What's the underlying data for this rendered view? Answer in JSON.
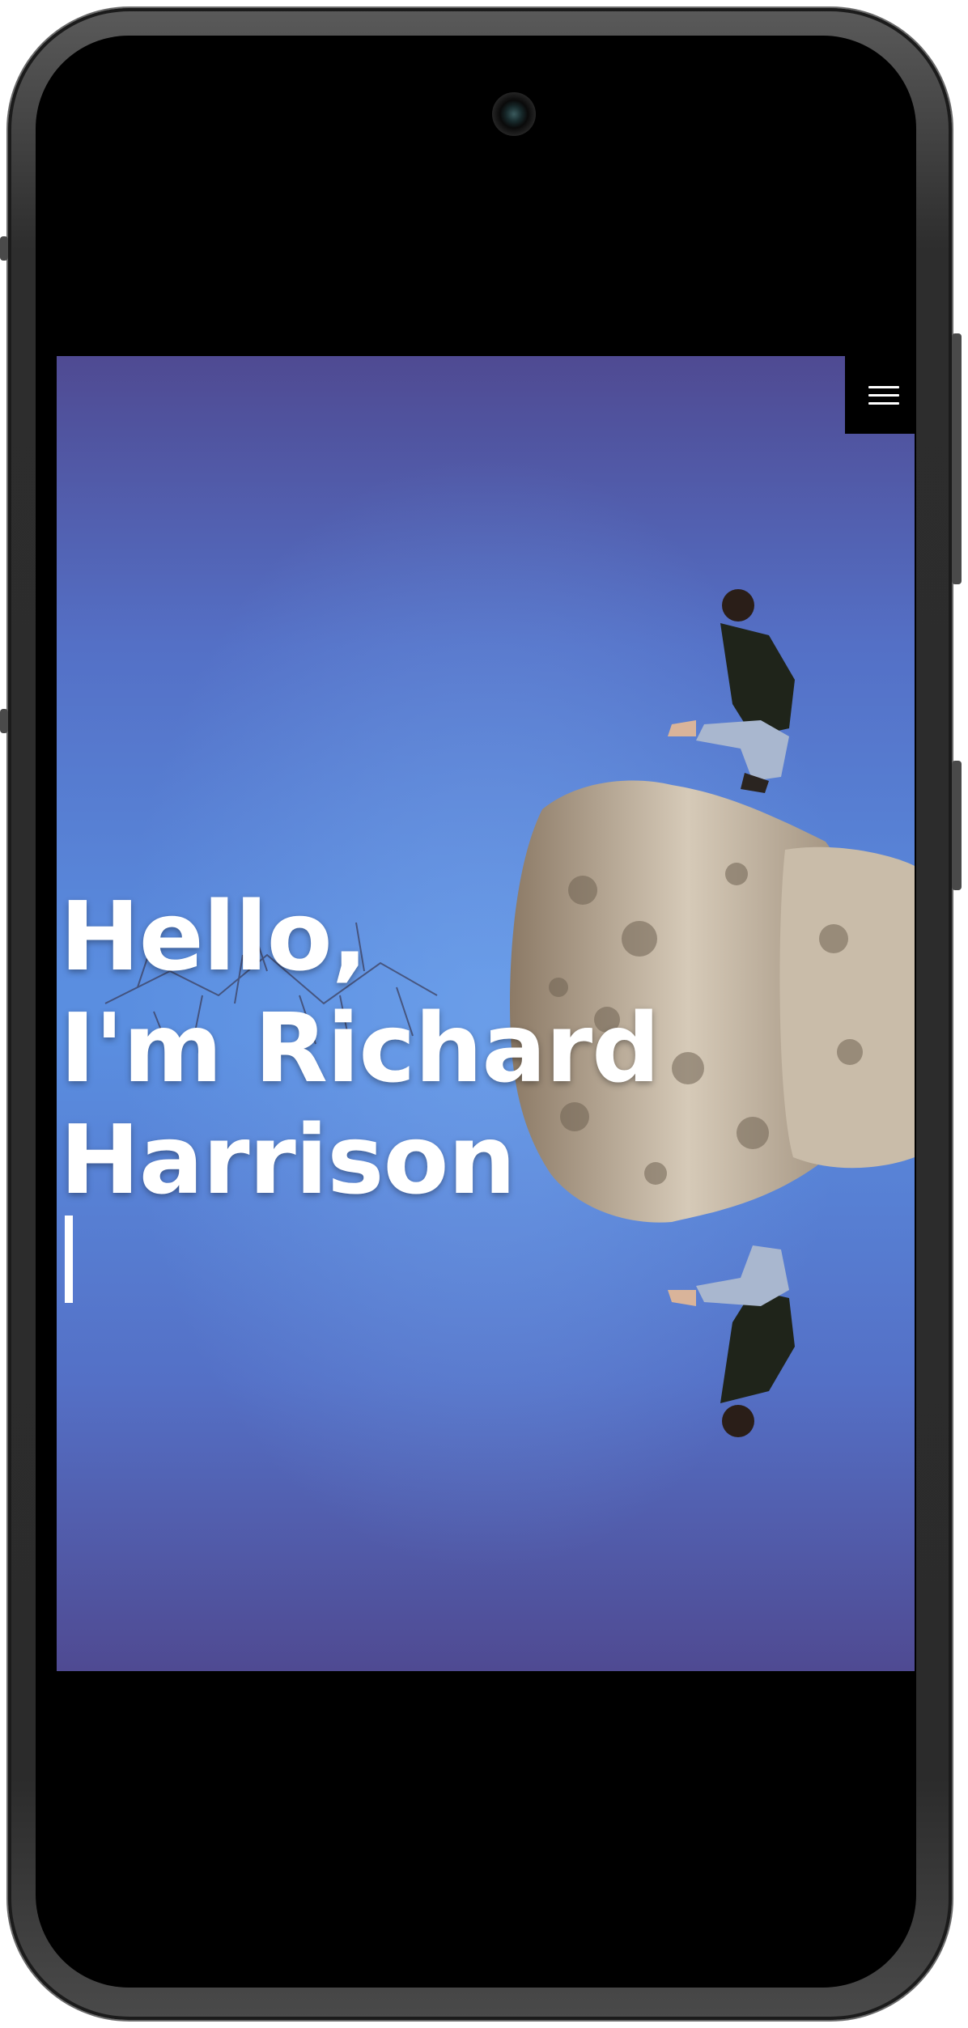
{
  "hero": {
    "greeting_line1": "Hello,",
    "greeting_line2": "I'm Richard",
    "greeting_line3": "Harrison",
    "cursor": "|"
  },
  "menu": {
    "icon": "hamburger-menu-icon"
  },
  "colors": {
    "sky_top": "#4f4a92",
    "sky_mid": "#5a8ee0",
    "menu_bg": "#000000",
    "text": "#ffffff"
  }
}
